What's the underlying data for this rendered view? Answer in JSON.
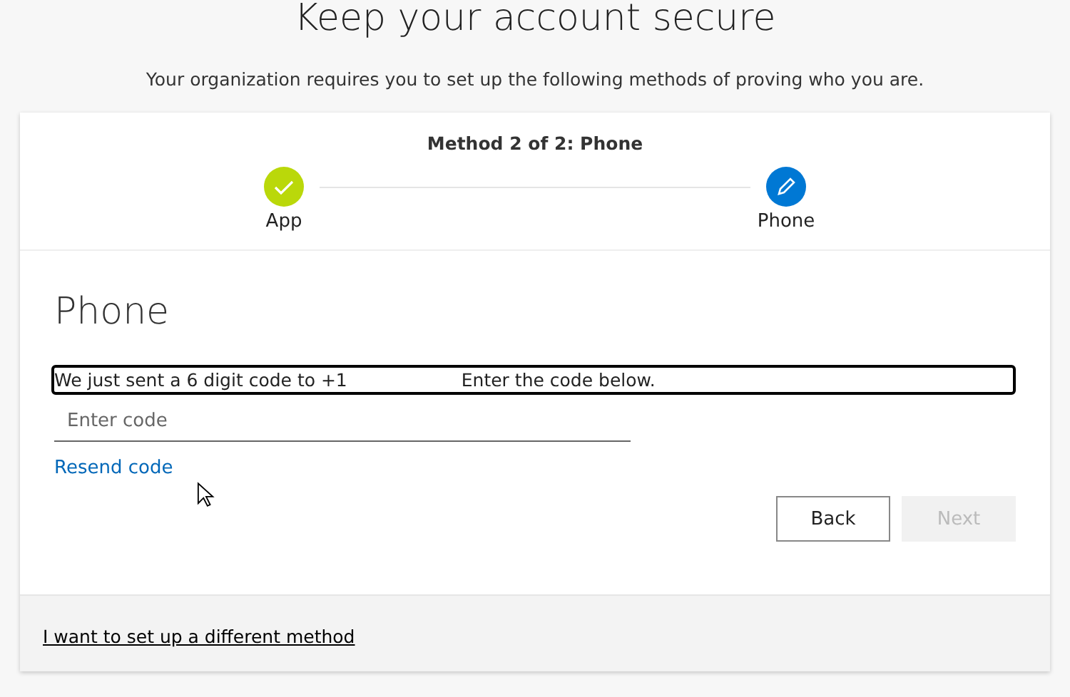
{
  "title": "Keep your account secure",
  "subtitle": "Your organization requires you to set up the following methods of proving who you are.",
  "progress": {
    "caption": "Method 2 of 2: Phone",
    "steps": [
      {
        "label": "App",
        "kind": "done"
      },
      {
        "label": "Phone",
        "kind": "current"
      }
    ]
  },
  "section": {
    "heading": "Phone",
    "message": {
      "before": "We just sent a 6 digit code to +1",
      "after": "Enter the code below."
    },
    "code_field": {
      "placeholder": "Enter code"
    },
    "resend_link": "Resend code",
    "buttons": [
      {
        "label": "Back",
        "disabled": false
      },
      {
        "label": "Next",
        "disabled": true
      }
    ]
  },
  "footer_link": "I want to set up a different method"
}
